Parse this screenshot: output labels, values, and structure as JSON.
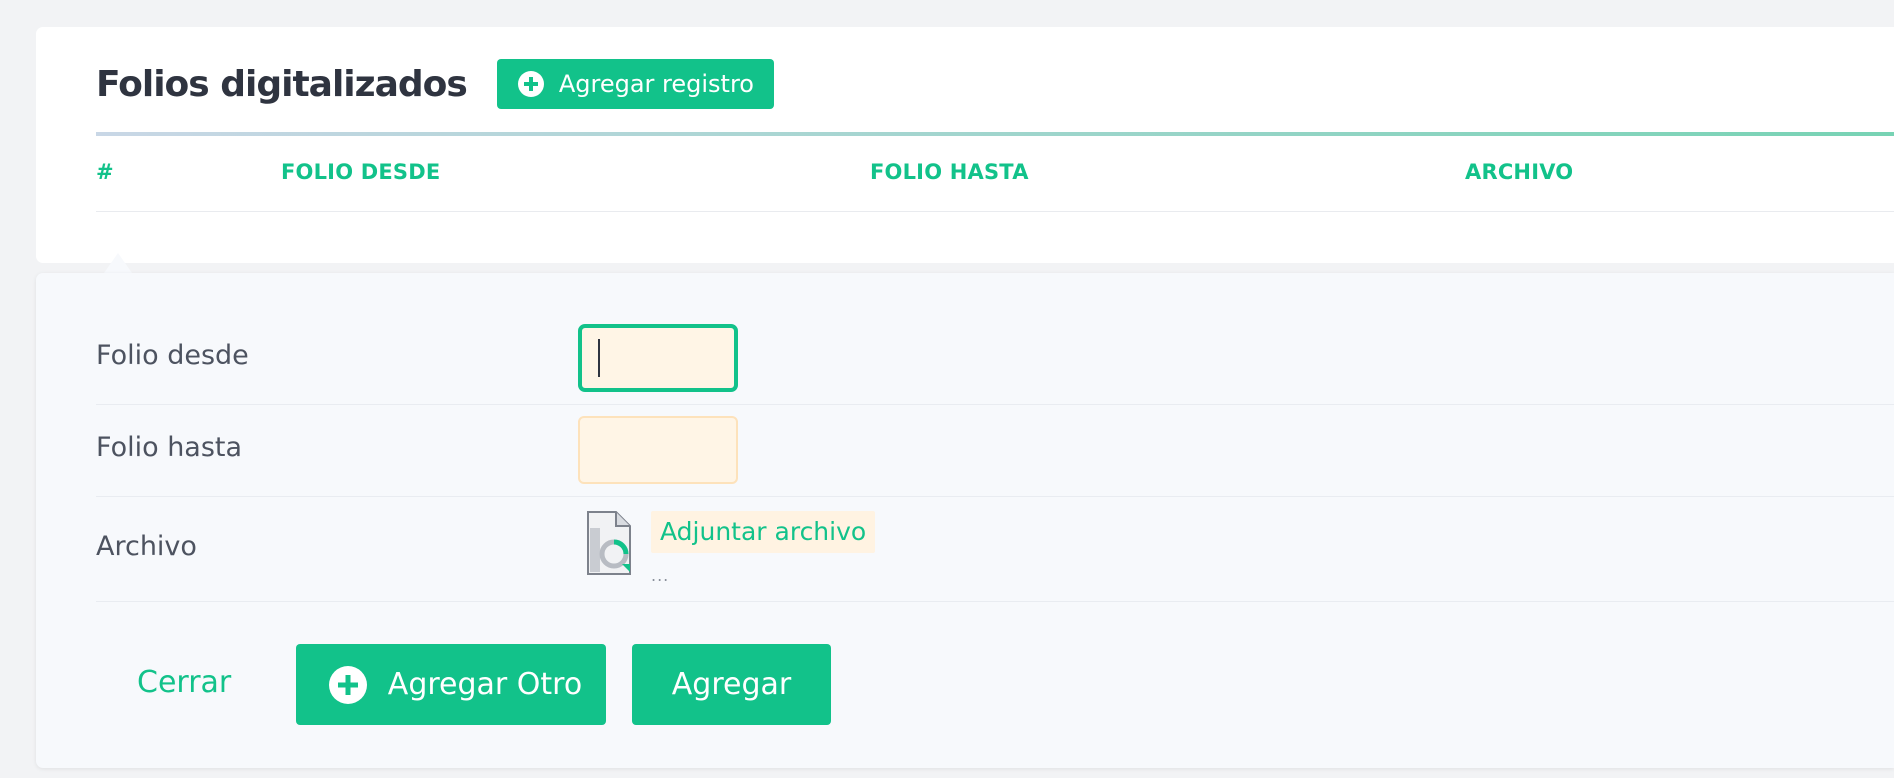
{
  "card": {
    "title": "Folios digitalizados",
    "add_record_label": "Agregar registro"
  },
  "table": {
    "columns": [
      "#",
      "FOLIO DESDE",
      "FOLIO HASTA",
      "ARCHIVO"
    ],
    "rows": []
  },
  "form": {
    "folio_desde": {
      "label": "Folio desde",
      "value": ""
    },
    "folio_hasta": {
      "label": "Folio hasta",
      "value": ""
    },
    "archivo": {
      "label": "Archivo",
      "attach_label": "Adjuntar archivo",
      "file_hint": "..."
    },
    "close_label": "Cerrar",
    "add_other_label": "Agregar Otro",
    "add_label": "Agregar"
  },
  "icons": {
    "add_record": "plus-circle-icon",
    "add_other": "plus-circle-icon",
    "file": "file-icon"
  },
  "colors": {
    "accent": "#12c28a",
    "input_background": "#fff5e6",
    "title": "#2f3440"
  }
}
